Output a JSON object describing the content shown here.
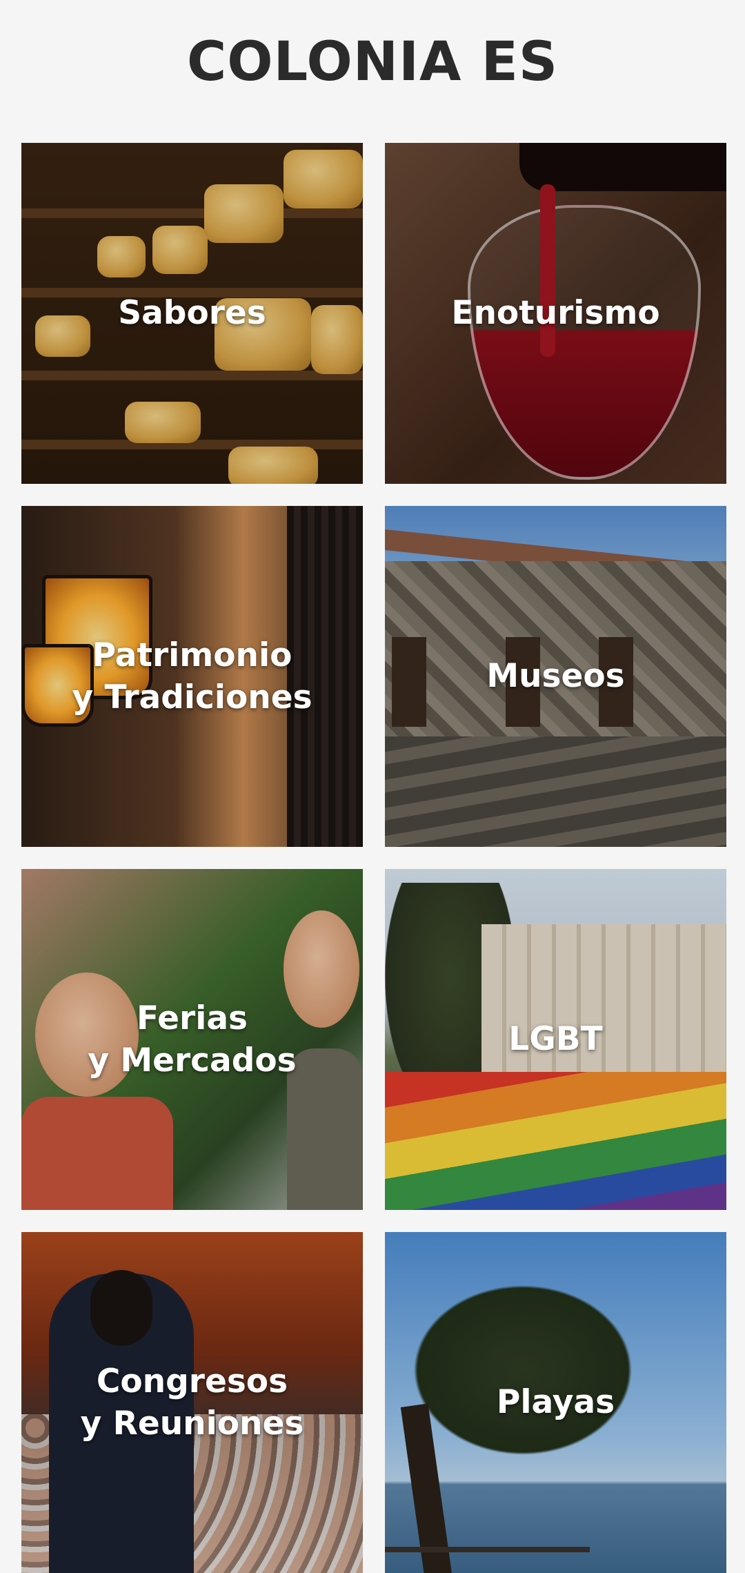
{
  "page": {
    "title": "COLONIA ES"
  },
  "tiles": [
    {
      "label": "Sabores"
    },
    {
      "label": "Enoturismo"
    },
    {
      "label": "Patrimonio\ny Tradiciones"
    },
    {
      "label": "Museos"
    },
    {
      "label": "Ferias\ny Mercados"
    },
    {
      "label": "LGBT"
    },
    {
      "label": "Congresos\ny Reuniones"
    },
    {
      "label": "Playas"
    }
  ],
  "colors": {
    "background": "#f5f5f5",
    "title": "#2b2b2b",
    "label": "#ffffff"
  }
}
